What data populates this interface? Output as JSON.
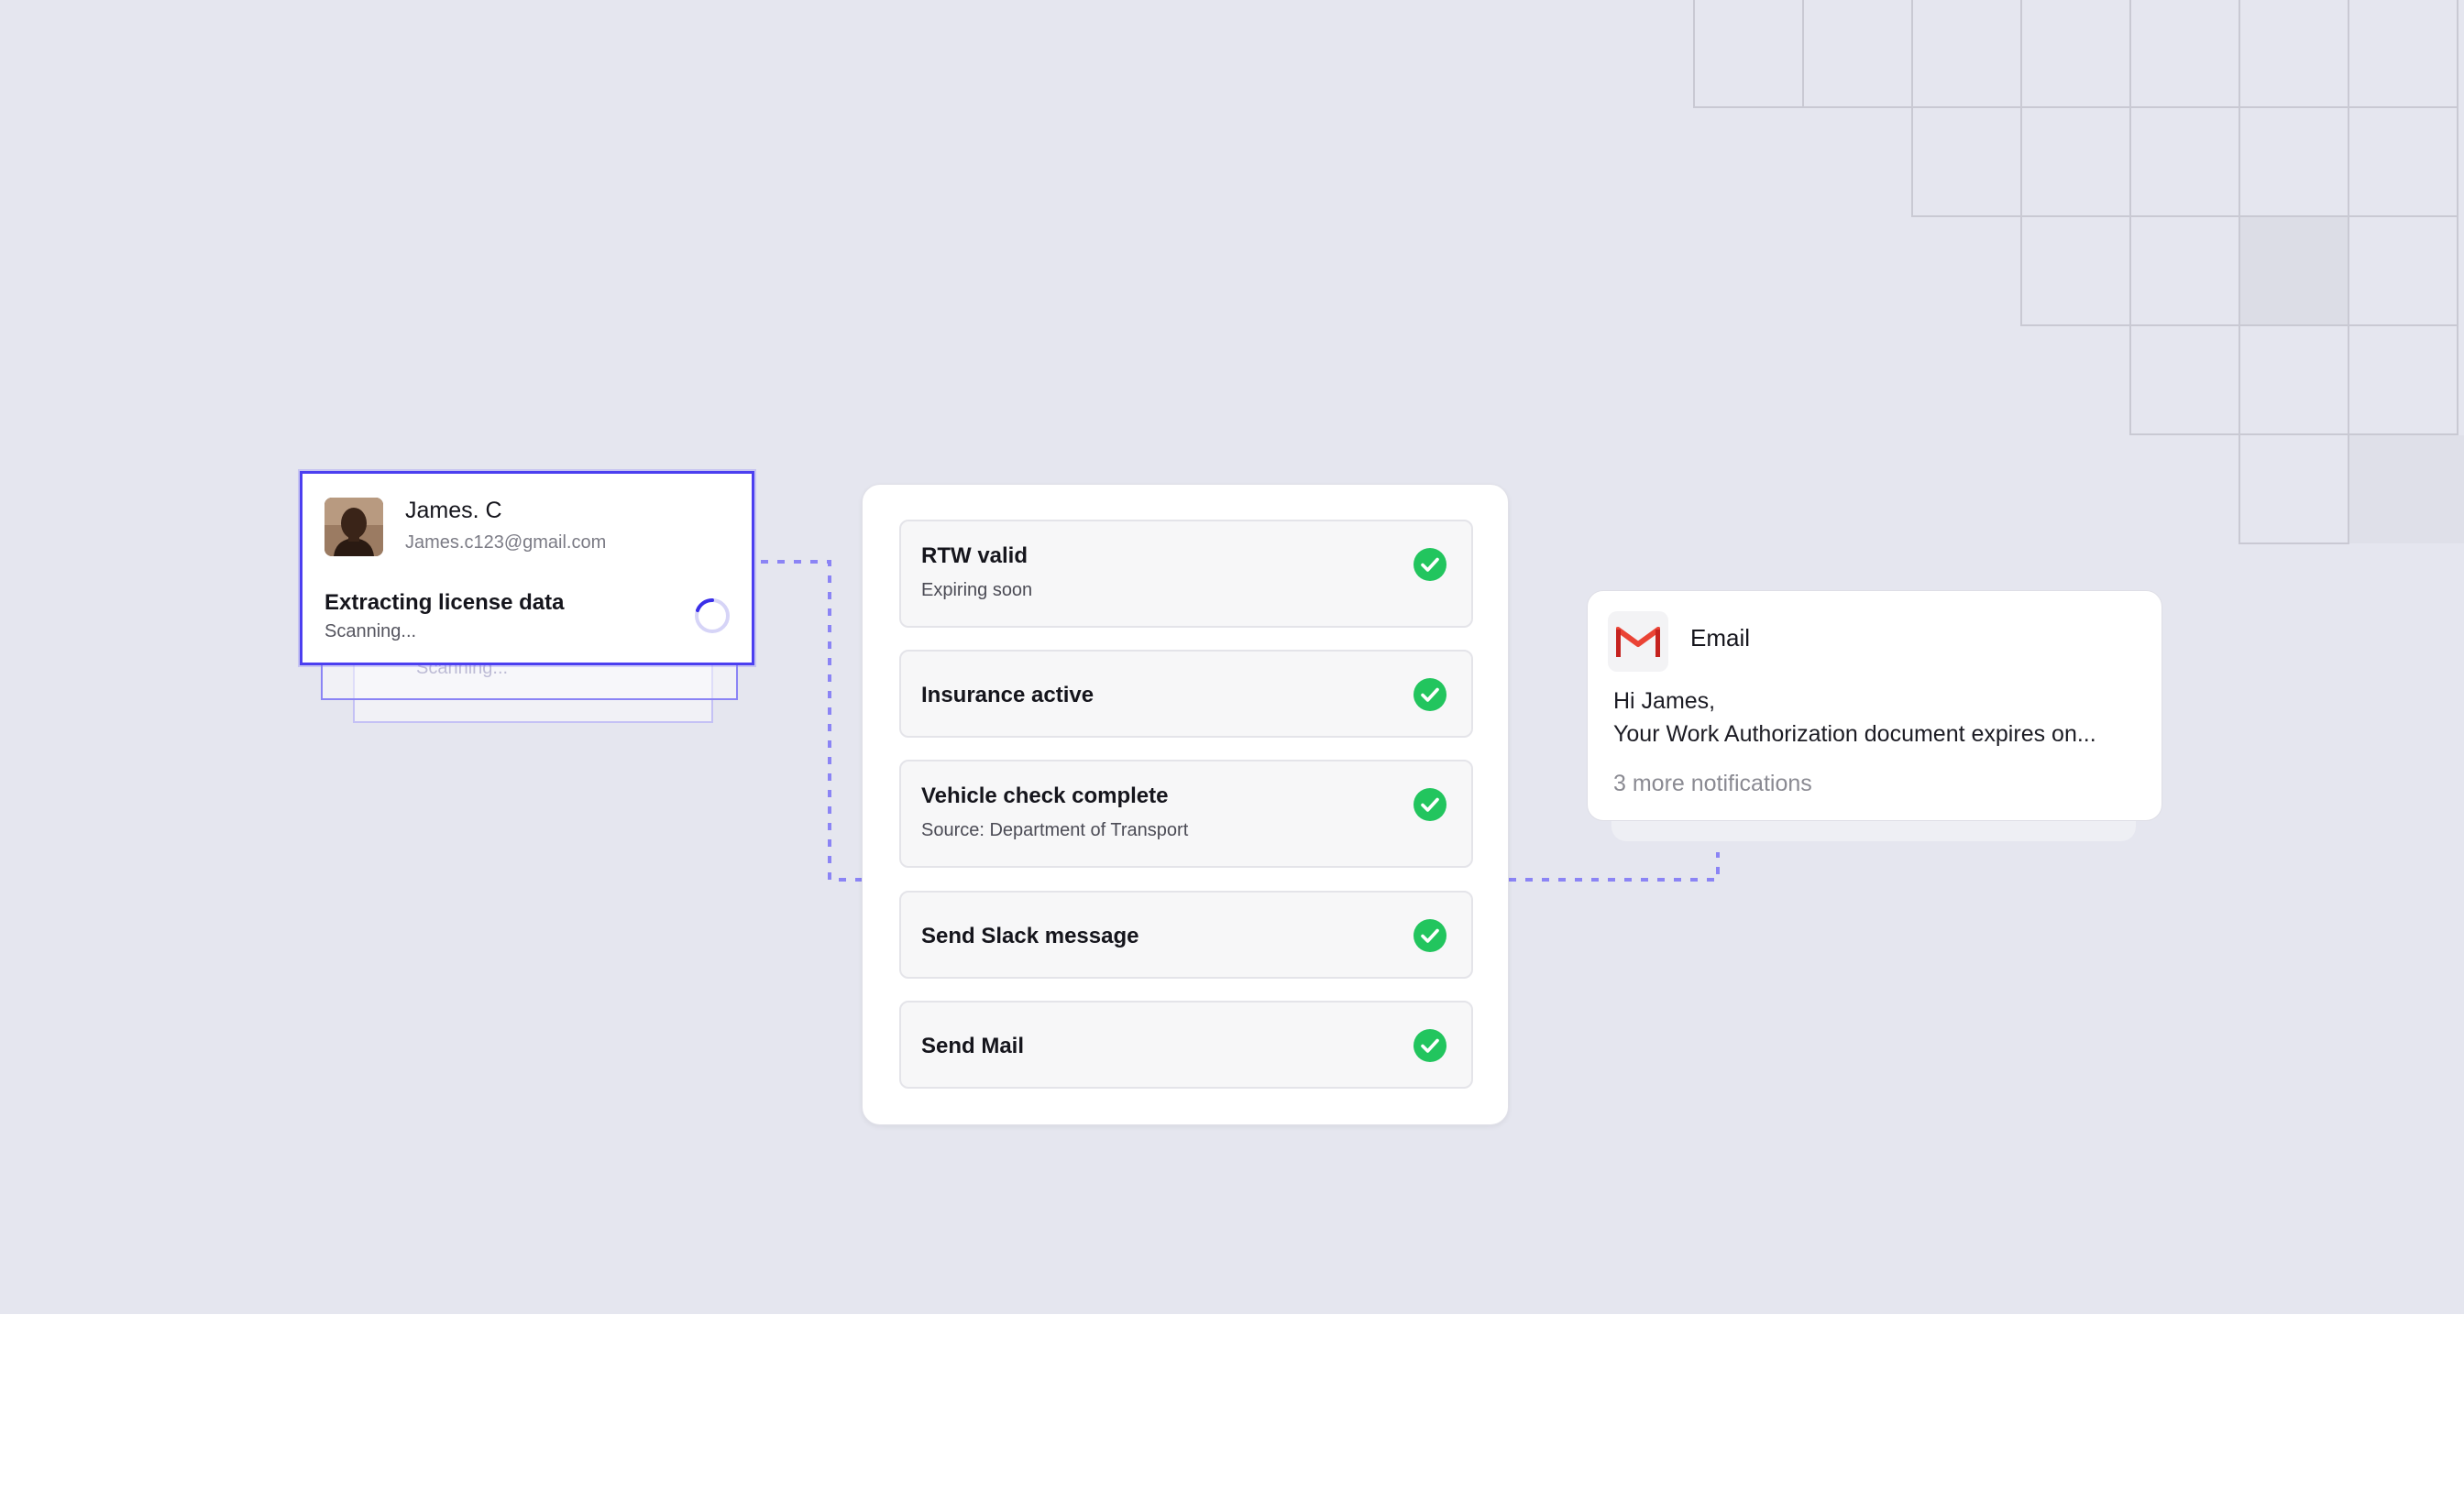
{
  "profile": {
    "name": "James. C",
    "email": "James.c123@gmail.com",
    "status_title": "Extracting license data",
    "status_sub": "Scanning...",
    "ghost_status": "Scanning..."
  },
  "checklist": [
    {
      "title": "RTW valid",
      "subtitle": "Expiring soon"
    },
    {
      "title": "Insurance active",
      "subtitle": ""
    },
    {
      "title": "Vehicle check complete",
      "subtitle": "Source: Department of Transport"
    },
    {
      "title": "Send Slack message",
      "subtitle": ""
    },
    {
      "title": "Send Mail",
      "subtitle": ""
    }
  ],
  "email": {
    "label": "Email",
    "greeting": "Hi James,",
    "message": "Your Work Authorization document expires on...",
    "more": "3 more notifications"
  },
  "colors": {
    "background": "#e5e6ef",
    "accent": "#4c3ff0",
    "success": "#22c55e",
    "connector": "#8b84f5",
    "gmail_red": "#ea4335"
  },
  "icons": {
    "check": "check-circle-icon",
    "spinner": "loading-spinner-icon",
    "gmail": "gmail-icon"
  }
}
